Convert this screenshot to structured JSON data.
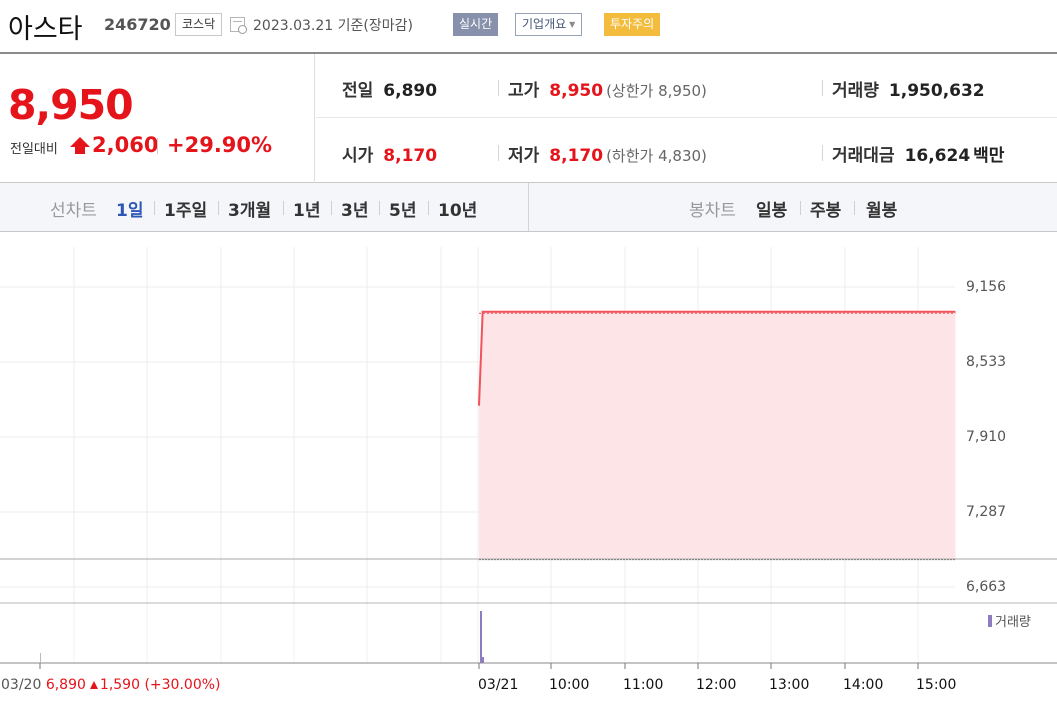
{
  "header": {
    "name": "아스타",
    "code": "246720",
    "market": "코스닥",
    "date": "2023.03.21",
    "date_suffix": "기준(장마감)",
    "realtime_label": "실시간",
    "company_label": "기업개요",
    "warning_label": "투자주의"
  },
  "summary": {
    "price": "8,950",
    "compare_label": "전일대비",
    "change": "2,060",
    "change_pct": "+29.90%",
    "prev_close": {
      "label": "전일",
      "value": "6,890"
    },
    "high": {
      "label": "고가",
      "value": "8,950",
      "note": "(상한가 8,950)"
    },
    "volume": {
      "label": "거래량",
      "value": "1,950,632"
    },
    "open": {
      "label": "시가",
      "value": "8,170"
    },
    "low": {
      "label": "저가",
      "value": "8,170",
      "note": "(하한가 4,830)"
    },
    "trade_value": {
      "label": "거래대금",
      "value": "16,624",
      "unit": "백만"
    }
  },
  "tabs": {
    "line_header": "선차트",
    "line": [
      "1일",
      "1주일",
      "3개월",
      "1년",
      "3년",
      "5년",
      "10년"
    ],
    "selected": "1일",
    "candle_header": "봉차트",
    "candle": [
      "일봉",
      "주봉",
      "월봉"
    ]
  },
  "colors": {
    "up": "#e5141b",
    "line": "#f2525a",
    "fill": "#fde4e6",
    "volume": "#8d7cc0",
    "selected_tab": "#2d56b7"
  },
  "chart_data": {
    "type": "area",
    "y_ticks": [
      "9,156",
      "8,533",
      "7,910",
      "7,287",
      "6,663"
    ],
    "ylim": [
      6663,
      9156
    ],
    "baseline": 6890,
    "x_labels": [
      "03/21",
      "10:00",
      "11:00",
      "12:00",
      "13:00",
      "14:00",
      "15:00"
    ],
    "series": [
      {
        "values": [
          {
            "t": "09:00",
            "y": 8170
          },
          {
            "t": "09:03",
            "y": 8950
          },
          {
            "t": "15:30",
            "y": 8950
          }
        ]
      }
    ],
    "volume_legend": "거래량",
    "prev_day": {
      "date": "03/20",
      "close": "6,890",
      "change": "1,590",
      "change_pct": "(+30.00%)"
    },
    "grid": true
  }
}
